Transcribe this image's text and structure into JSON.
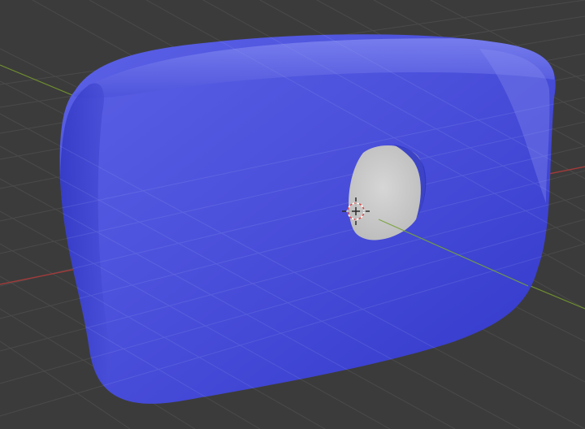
{
  "viewport": {
    "mode": "3D viewport",
    "background_color": "#3b3b3b",
    "grid_color": "#4a4a4a",
    "axis_colors": {
      "x_axis": "#a33a3a",
      "y_axis": "#6f8f2f"
    }
  },
  "scene": {
    "object": {
      "type": "rounded-box-with-hole",
      "color": "#4a4fd8",
      "hole_color": "#c8c8c8"
    },
    "cursor": {
      "type": "3d-cursor",
      "colors": [
        "#d84a4a",
        "#f2f2f2",
        "#2b2b2b"
      ]
    }
  }
}
